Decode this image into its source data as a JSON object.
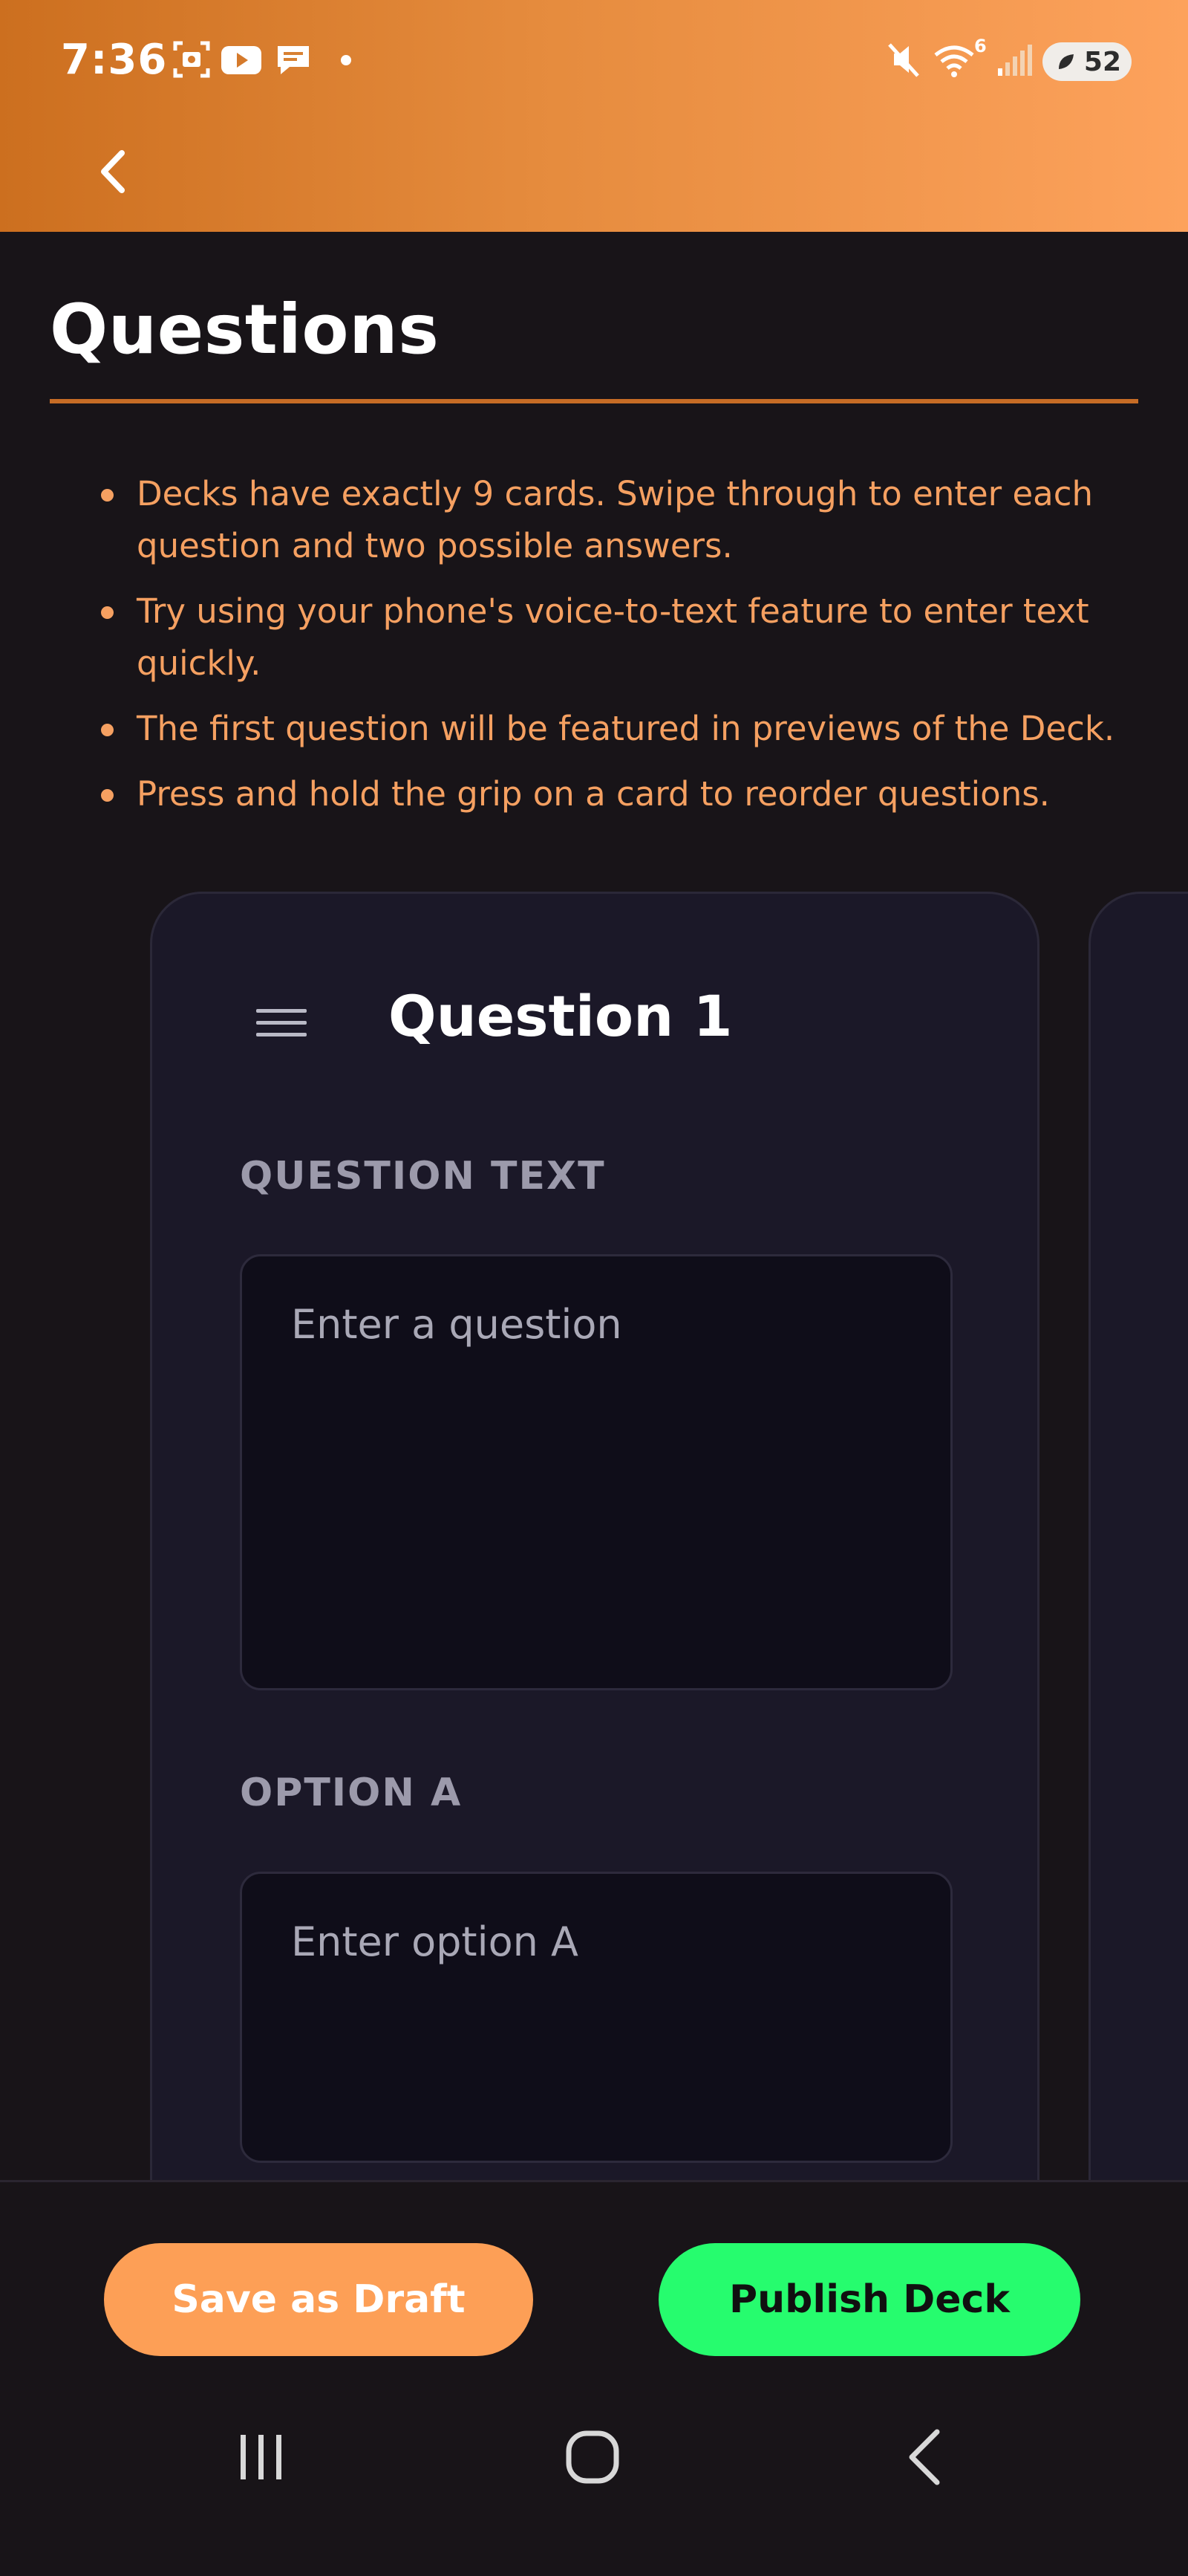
{
  "status_bar": {
    "time": "7:36",
    "battery": "52",
    "wifi_superscript": "6"
  },
  "header": {
    "gradient_start": "#cc6f1f",
    "gradient_end": "#fda25c",
    "back_icon": "chevron-left-icon"
  },
  "page": {
    "title": "Questions"
  },
  "instructions": [
    "Decks have exactly 9 cards. Swipe through to enter each question and two possible answers.",
    "Try using your phone's voice-to-text feature to enter text quickly.",
    "The first question will be featured in previews of the Deck.",
    "Press and hold the grip on a card to reorder questions."
  ],
  "card": {
    "title": "Question 1",
    "grip_icon": "grip-lines-icon",
    "question_label": "QUESTION TEXT",
    "question_placeholder": "Enter a question",
    "question_value": "",
    "option_a_label": "OPTION A",
    "option_a_placeholder": "Enter option A",
    "option_a_value": ""
  },
  "actions": {
    "draft_label": "Save as Draft",
    "publish_label": "Publish Deck",
    "draft_color": "#fd9f56",
    "publish_color": "#26fc6e"
  },
  "nav": {
    "recents_icon": "recents-icon",
    "home_icon": "home-icon",
    "back_icon": "back-icon"
  }
}
